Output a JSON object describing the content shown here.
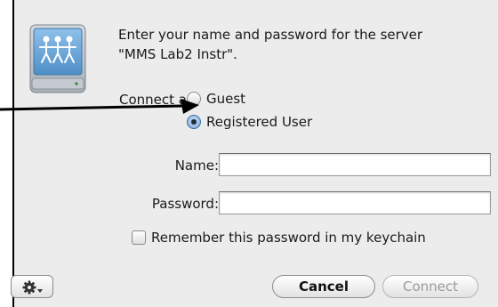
{
  "dialog": {
    "message_line1": "Enter your name and password for the server",
    "message_line2": "\"MMS Lab2 Instr\".",
    "connect_as_label": "Connect as:",
    "guest_label": "Guest",
    "registered_label": "Registered User",
    "selected_option": "Registered User",
    "name_label": "Name:",
    "name_value": "",
    "password_label": "Password:",
    "password_value": "",
    "remember_label": "Remember this password in my keychain",
    "remember_checked": false,
    "gear_menu_icon": "gear-icon",
    "cancel_label": "Cancel",
    "connect_label": "Connect",
    "connect_enabled": false
  },
  "colors": {
    "dialog_background": "#ececec",
    "radio_selected": "#7aa7d8",
    "disabled_text": "#9a9a9a"
  }
}
